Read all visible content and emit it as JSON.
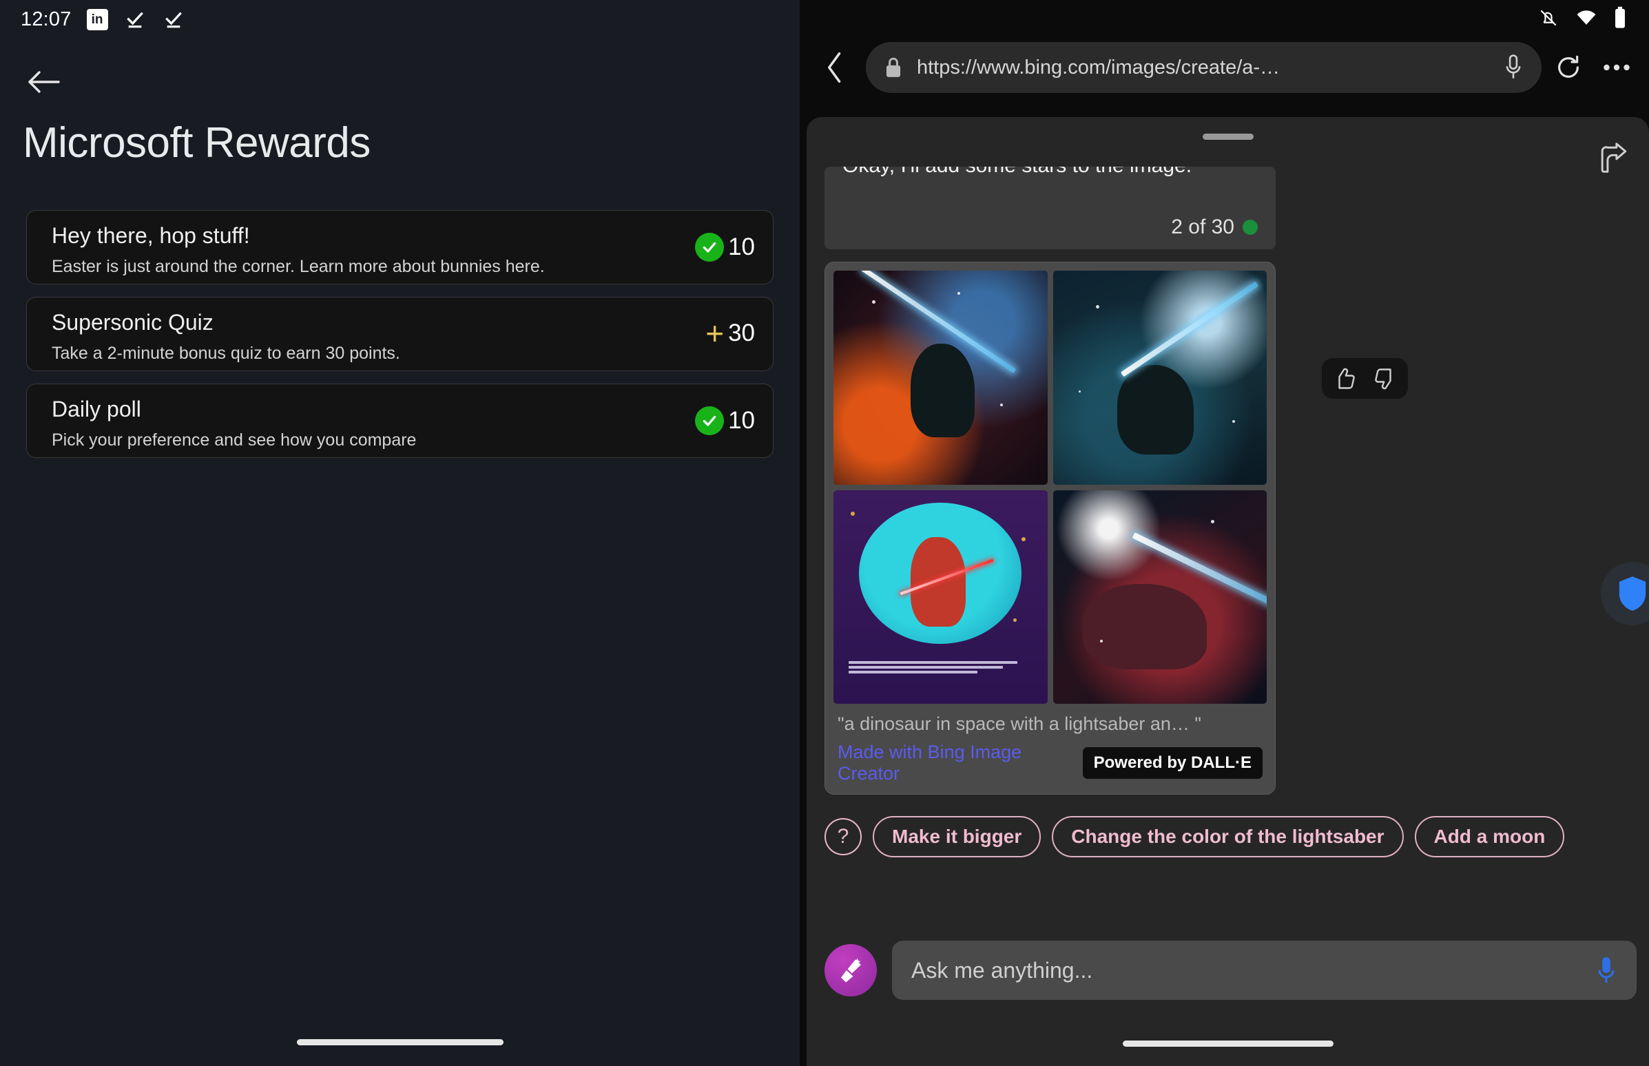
{
  "left": {
    "status": {
      "time": "12:07",
      "icons": [
        "linkedin-icon",
        "check-underline-icon",
        "check-underline-icon"
      ]
    },
    "back_label": "Back",
    "title": "Microsoft Rewards",
    "cards": [
      {
        "title": "Hey there, hop stuff!",
        "subtitle": "Easter is just around the corner. Learn more about bunnies here.",
        "points": "10",
        "state": "complete",
        "icon": "check-circle-icon"
      },
      {
        "title": "Supersonic Quiz",
        "subtitle": "Take a 2-minute bonus quiz to earn 30 points.",
        "points": "30",
        "state": "available",
        "icon": "plus-icon"
      },
      {
        "title": "Daily poll",
        "subtitle": "Pick your preference and see how you compare",
        "points": "10",
        "state": "complete",
        "icon": "check-circle-icon"
      }
    ]
  },
  "right": {
    "status": {
      "icons": [
        "bell-muted-icon",
        "wifi-icon",
        "battery-icon"
      ]
    },
    "browser": {
      "url": "https://www.bing.com/images/create/a-…",
      "lock_icon": "lock-icon",
      "mic_icon": "microphone-icon",
      "reload_icon": "reload-icon",
      "more_icon": "more-horizontal-icon",
      "back_icon": "chevron-left-icon"
    },
    "sheet": {
      "share_icon": "share-icon",
      "clipped_message": "Okay, I'll add some stars to the image.",
      "counter": "2 of 30",
      "feedback": {
        "up_icon": "thumbs-up-icon",
        "down_icon": "thumbs-down-icon"
      }
    },
    "image_card": {
      "caption": "\"a dinosaur in space with a lightsaber an…  \"",
      "made_with": "Made with Bing Image Creator",
      "badge": "Powered by DALL·E",
      "thumbs": [
        "dinosaur-nebula-lightsaber",
        "dinosaur-blue-lightsaber",
        "dinosaur-poster-red-lightsaber",
        "dinosaur-head-lightsaber"
      ]
    },
    "suggestions": {
      "help_label": "?",
      "chips": [
        "Make it bigger",
        "Change the color of the lightsaber",
        "Add a moon"
      ]
    },
    "composer": {
      "avatar_icon": "bing-broom-icon",
      "placeholder": "Ask me anything...",
      "mic_icon": "microphone-blue-icon"
    }
  },
  "colors": {
    "left_bg": "#191b23",
    "card_bg": "#131313",
    "points_green": "#19b319",
    "points_gold": "#e8c55a",
    "chip_pink": "#f0bcd0",
    "link_blue": "#5b5bf0",
    "sheet_bg": "#262626"
  }
}
